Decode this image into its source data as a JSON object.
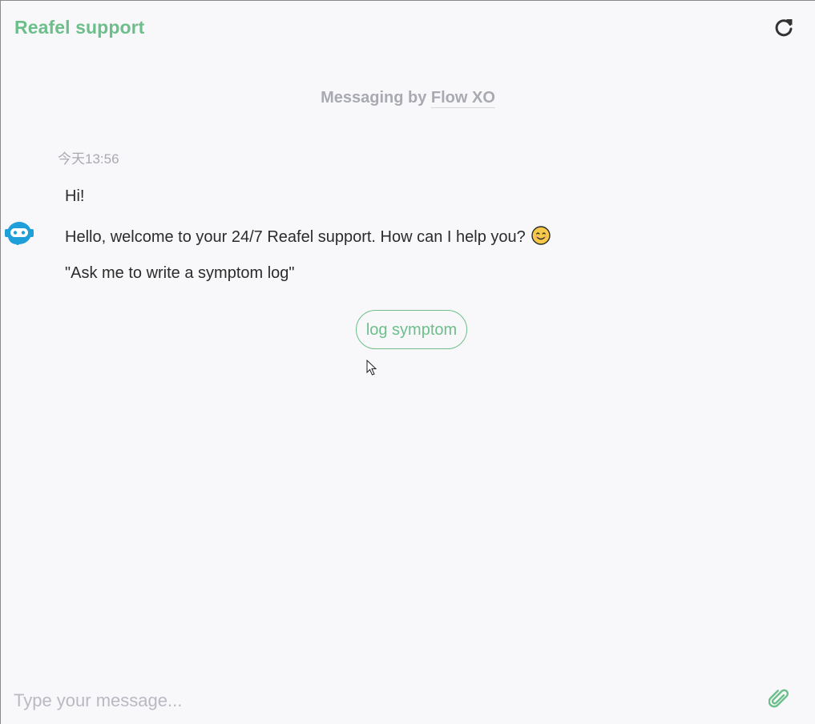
{
  "header": {
    "title": "Reafel support",
    "refresh_icon": "refresh-icon"
  },
  "branding": {
    "prefix": "Messaging by ",
    "link": "Flow XO"
  },
  "conversation": {
    "timestamp": "今天13:56",
    "avatar_icon": "bot-avatar-icon",
    "messages": [
      {
        "text": "Hi!"
      },
      {
        "text": "Hello, welcome to your 24/7 Reafel support. How can I help you?",
        "emoji": "smiling-face-icon"
      },
      {
        "text": "\"Ask me to write a symptom log\""
      }
    ],
    "quick_replies": [
      {
        "label": "log symptom"
      }
    ]
  },
  "composer": {
    "placeholder": "Type your message...",
    "value": "",
    "attach_icon": "paperclip-icon"
  },
  "colors": {
    "accent": "#6cbf8b",
    "muted": "#a9a9b2",
    "text": "#2b2b2b",
    "background": "#f8f8fa",
    "avatar": "#1f9fd9"
  }
}
